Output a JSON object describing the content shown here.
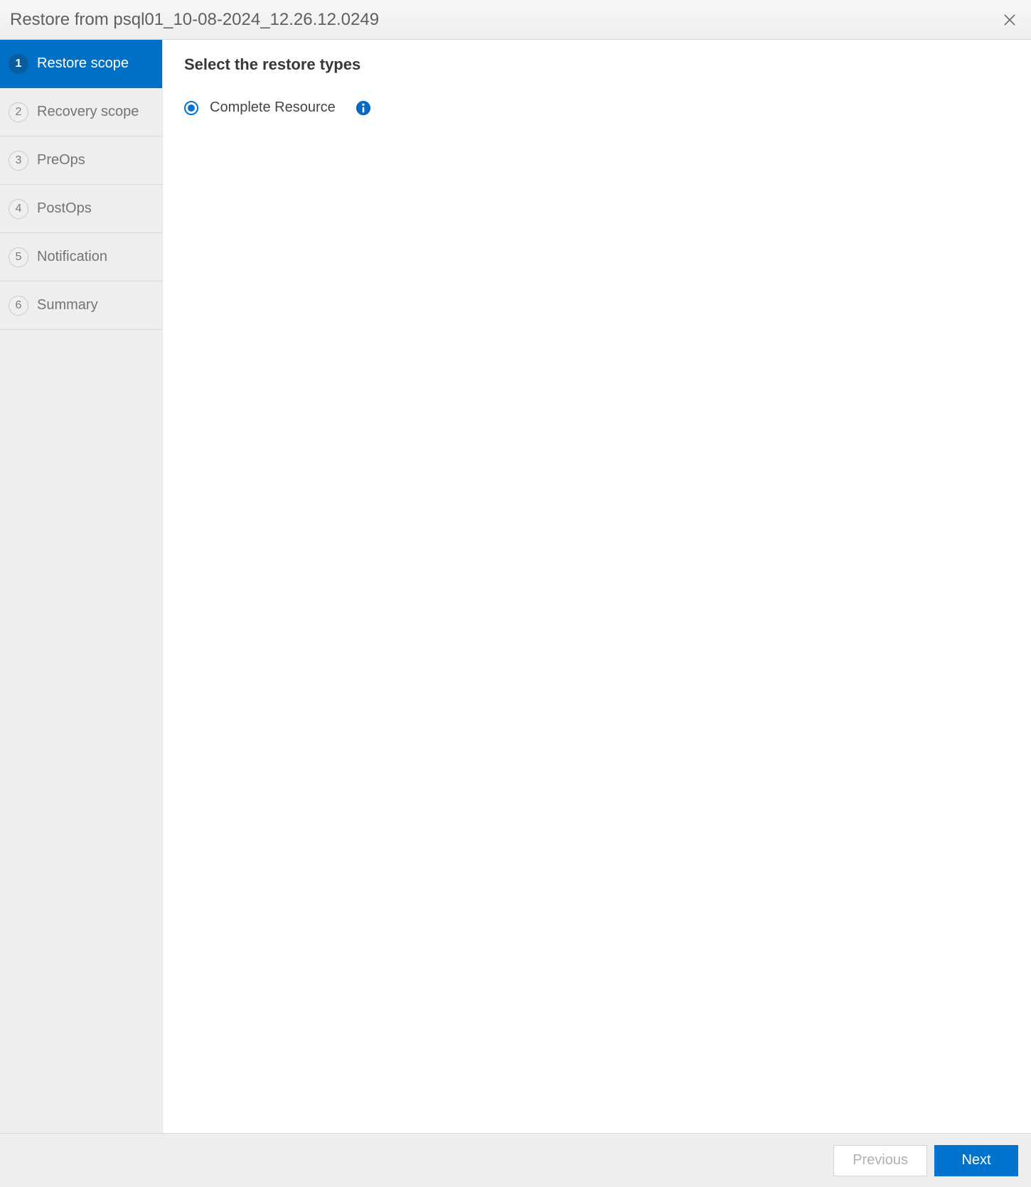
{
  "header": {
    "title": "Restore from psql01_10-08-2024_12.26.12.0249"
  },
  "sidebar": {
    "steps": [
      {
        "num": "1",
        "label": "Restore scope",
        "active": true
      },
      {
        "num": "2",
        "label": "Recovery scope",
        "active": false
      },
      {
        "num": "3",
        "label": "PreOps",
        "active": false
      },
      {
        "num": "4",
        "label": "PostOps",
        "active": false
      },
      {
        "num": "5",
        "label": "Notification",
        "active": false
      },
      {
        "num": "6",
        "label": "Summary",
        "active": false
      }
    ]
  },
  "content": {
    "heading": "Select the restore types",
    "option_complete_resource": "Complete Resource"
  },
  "footer": {
    "previous": "Previous",
    "next": "Next"
  }
}
